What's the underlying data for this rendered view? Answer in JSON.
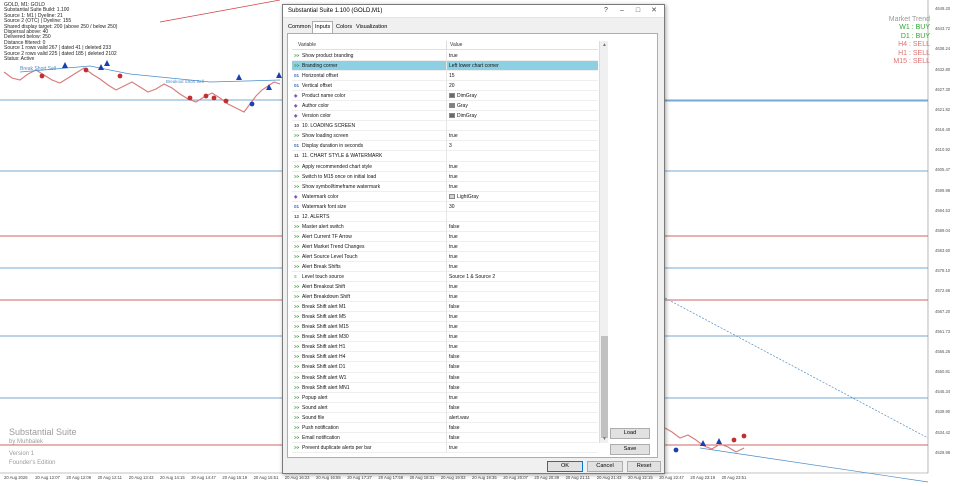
{
  "chart": {
    "info_lines": [
      "GOLD, M1: GOLD",
      "Substantial Suite Build: 1.100",
      "Source 1: M1 | Dyeline: 21",
      "Source 2 (OTC) | Dyeline: 155",
      "Shared display target: 200 (above 250 / below 250)",
      "Dispersal above: 40",
      "Delivered below: 250",
      "Distance filtered: 0",
      "Source 1 rows valid 267 | dated 41 | deleted 233",
      "Source 2 rows valid 225 | dated 185 | deleted 2102",
      "Status: Active"
    ],
    "market_trend": {
      "title": "Market Trend",
      "rows": [
        {
          "label": "W1 : BUY",
          "color": "#2ea82e"
        },
        {
          "label": "D1 : BUY",
          "color": "#2ea82e"
        },
        {
          "label": "H4 : SELL",
          "color": "#e07070"
        },
        {
          "label": "H1 : SELL",
          "color": "#e07070"
        },
        {
          "label": "M15 : SELL",
          "color": "#e07070"
        }
      ]
    },
    "price_labels": [
      "4649.20",
      "4643.72",
      "4638.24",
      "4632.80",
      "4627.30",
      "4621.82",
      "4616.40",
      "4610.92",
      "4605.47",
      "4599.98",
      "4594.53",
      "4589.04",
      "4583.60",
      "4578.10",
      "4572.66",
      "4567.20",
      "4561.73",
      "4556.26",
      "4550.81",
      "4545.34",
      "4539.90",
      "4534.42",
      "4528.98"
    ],
    "time_labels": [
      "20 Aug 2026",
      "20 Aug 12:07",
      "20 Aug 12:09",
      "20 Aug 12:11",
      "20 Aug 13:43",
      "20 Aug 14:15",
      "20 Aug 14:47",
      "20 Aug 15:19",
      "20 Aug 15:51",
      "20 Aug 16:23",
      "20 Aug 16:55",
      "20 Aug 17:27",
      "20 Aug 17:59",
      "20 Aug 18:31",
      "20 Aug 19:03",
      "20 Aug 19:35",
      "20 Aug 20:07",
      "20 Aug 20:39",
      "20 Aug 21:11",
      "20 Aug 21:43",
      "20 Aug 22:15",
      "20 Aug 22:47",
      "20 Aug 23:19",
      "20 Aug 23:51"
    ],
    "annotations": {
      "break_short": "Break Short Sell",
      "bull_label": "Breakout Short Sell"
    },
    "watermark": {
      "title": "Substantial Suite",
      "by": "by Muhbalek",
      "version": "Version 1",
      "edition": "Founder's Edition"
    }
  },
  "dialog": {
    "title": "Substantial Suite 1.100 (GOLD,M1)",
    "tabs": [
      "Common",
      "Inputs",
      "Colors",
      "Visualization"
    ],
    "active_tab": "Inputs",
    "columns": {
      "variable": "Variable",
      "value": "Value"
    },
    "rows": [
      {
        "icon": "ab",
        "name": "Show product branding",
        "value": "true"
      },
      {
        "icon": "ab",
        "name": "Branding corner",
        "value": "Left lower chart corner",
        "selected": true
      },
      {
        "icon": "01",
        "name": "Horizontal offset",
        "value": "15"
      },
      {
        "icon": "01",
        "name": "Vertical offset",
        "value": "20"
      },
      {
        "icon": "clr",
        "name": "Product name color",
        "value": "DimGray",
        "swatch": "#696969"
      },
      {
        "icon": "clr",
        "name": "Author color",
        "value": "Gray",
        "swatch": "#808080"
      },
      {
        "icon": "clr",
        "name": "Version color",
        "value": "DimGray",
        "swatch": "#696969"
      },
      {
        "icon": "10",
        "name": "10. LOADING SCREEN",
        "value": ""
      },
      {
        "icon": "ab",
        "name": "Show loading screen",
        "value": "true"
      },
      {
        "icon": "01",
        "name": "Display duration in seconds",
        "value": "3"
      },
      {
        "icon": "11",
        "name": "11. CHART STYLE & WATERMARK",
        "value": ""
      },
      {
        "icon": "ab",
        "name": "Apply recommended chart style",
        "value": "true"
      },
      {
        "icon": "ab",
        "name": "Switch to M15 once on initial load",
        "value": "true"
      },
      {
        "icon": "ab",
        "name": "Show symbol/timeframe watermark",
        "value": "true"
      },
      {
        "icon": "clr",
        "name": "Watermark color",
        "value": "LightGray",
        "swatch": "#d3d3d3"
      },
      {
        "icon": "01",
        "name": "Watermark font size",
        "value": "30"
      },
      {
        "icon": "12",
        "name": "12. ALERTS",
        "value": ""
      },
      {
        "icon": "ab",
        "name": "Master alert switch",
        "value": "false"
      },
      {
        "icon": "ab",
        "name": "Alert Current TF Arrow",
        "value": "true"
      },
      {
        "icon": "ab",
        "name": "Alert Market Trend Changes",
        "value": "true"
      },
      {
        "icon": "ab",
        "name": "Alert Source Level Touch",
        "value": "true"
      },
      {
        "icon": "ab",
        "name": "Alert Break Shifts",
        "value": "true"
      },
      {
        "icon": "enum",
        "name": "Level touch source",
        "value": "Source 1 & Source 2"
      },
      {
        "icon": "ab",
        "name": "Alert Breakout Shift",
        "value": "true"
      },
      {
        "icon": "ab",
        "name": "Alert Breakdown Shift",
        "value": "true"
      },
      {
        "icon": "ab",
        "name": "Break Shift alert M1",
        "value": "false"
      },
      {
        "icon": "ab",
        "name": "Break Shift alert M5",
        "value": "true"
      },
      {
        "icon": "ab",
        "name": "Break Shift alert M15",
        "value": "true"
      },
      {
        "icon": "ab",
        "name": "Break Shift alert M30",
        "value": "true"
      },
      {
        "icon": "ab",
        "name": "Break Shift alert H1",
        "value": "true"
      },
      {
        "icon": "ab",
        "name": "Break Shift alert H4",
        "value": "false"
      },
      {
        "icon": "ab",
        "name": "Break Shift alert D1",
        "value": "false"
      },
      {
        "icon": "ab",
        "name": "Break Shift alert W1",
        "value": "false"
      },
      {
        "icon": "ab",
        "name": "Break Shift alert MN1",
        "value": "false"
      },
      {
        "icon": "ab",
        "name": "Popup alert",
        "value": "true"
      },
      {
        "icon": "ab",
        "name": "Sound alert",
        "value": "false"
      },
      {
        "icon": "ab",
        "name": "Sound file",
        "value": "alert.wav"
      },
      {
        "icon": "ab",
        "name": "Push notification",
        "value": "false"
      },
      {
        "icon": "ab",
        "name": "Email notification",
        "value": "false"
      },
      {
        "icon": "ab",
        "name": "Prevent duplicate alerts per bar",
        "value": "true"
      }
    ],
    "buttons": {
      "load": "Load",
      "save": "Save",
      "ok": "OK",
      "cancel": "Cancel",
      "reset": "Reset"
    }
  }
}
